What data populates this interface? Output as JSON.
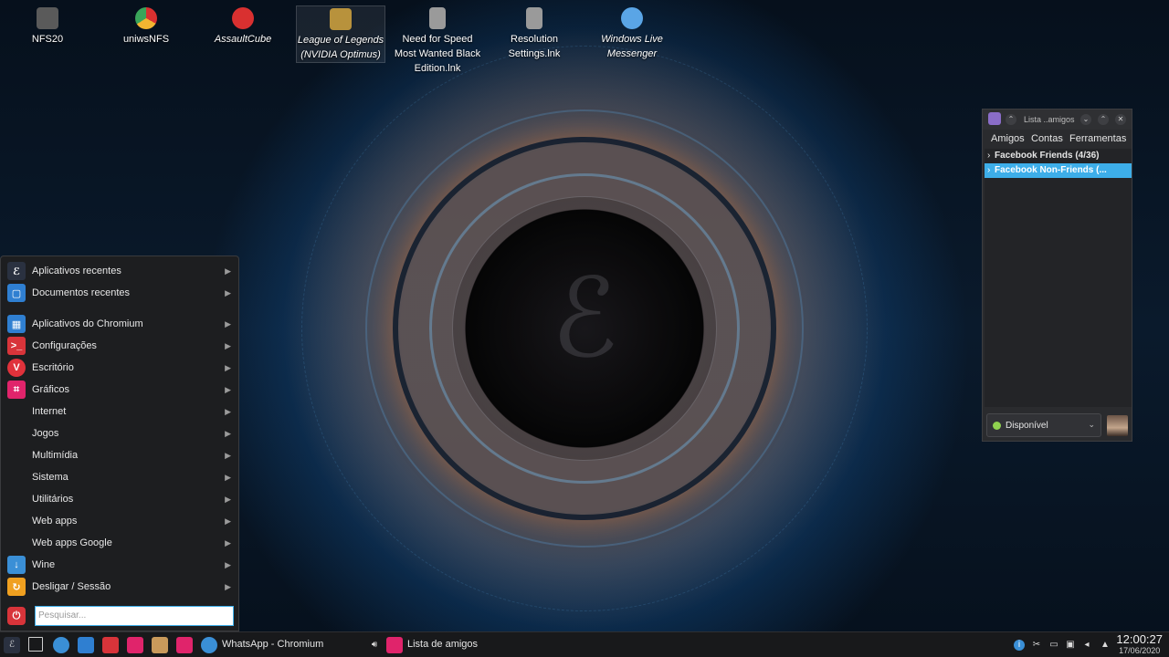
{
  "desktop": {
    "icons": [
      {
        "label": "NFS20",
        "color": "#5a5a5a"
      },
      {
        "label": "uniwsNFS",
        "color": "#f2b531"
      },
      {
        "label": "AssaultCube",
        "color": "#d93030"
      },
      {
        "label": "League of Legends (NVIDIA Optimus)",
        "color": "#b8923c"
      },
      {
        "label": "Need for Speed Most Wanted Black Edition.lnk",
        "color": "#9a9a9a"
      },
      {
        "label": "Resolution Settings.lnk",
        "color": "#9a9a9a"
      },
      {
        "label": "Windows Live Messenger",
        "color": "#5aa5e6"
      }
    ]
  },
  "start_menu": {
    "items": [
      {
        "label": "Aplicativos recentes",
        "icon": "dragon-logo-icon",
        "color": "#2a3140"
      },
      {
        "label": "Documentos recentes",
        "icon": "document-icon",
        "color": "#2f7fd1"
      },
      {
        "label": "Aplicativos do Chromium",
        "icon": "grid-apps-icon",
        "color": "#2f7fd1"
      },
      {
        "label": "Configurações",
        "icon": "terminal-icon",
        "color": "#d8343a"
      },
      {
        "label": "Escritório",
        "icon": "vivaldi-icon",
        "color": "#e0323b"
      },
      {
        "label": "Gráficos",
        "icon": "crop-icon",
        "color": "#e0246b"
      },
      {
        "label": "Internet",
        "icon": "",
        "color": ""
      },
      {
        "label": "Jogos",
        "icon": "",
        "color": ""
      },
      {
        "label": "Multimídia",
        "icon": "",
        "color": ""
      },
      {
        "label": "Sistema",
        "icon": "",
        "color": ""
      },
      {
        "label": "Utilitários",
        "icon": "",
        "color": ""
      },
      {
        "label": "Web apps",
        "icon": "",
        "color": ""
      },
      {
        "label": "Web apps Google",
        "icon": "",
        "color": ""
      },
      {
        "label": "Wine",
        "icon": "download-icon",
        "color": "#3a8fd6"
      },
      {
        "label": "Desligar / Sessão",
        "icon": "refresh-icon",
        "color": "#f0a020"
      }
    ],
    "power_icon_color": "#d8343a",
    "search_placeholder": "Pesquisar..."
  },
  "friends_window": {
    "title": "Lista ..amigos",
    "menu": [
      "Amigos",
      "Contas",
      "Ferramentas"
    ],
    "groups": [
      {
        "label": "Facebook Friends (4/36)",
        "selected": false
      },
      {
        "label": "Facebook Non-Friends (...",
        "selected": true
      }
    ],
    "status": "Disponível",
    "status_color": "#8fd14f"
  },
  "taskbar": {
    "launchers": [
      {
        "name": "show-desktop-icon",
        "color": "#2a2b2e"
      },
      {
        "name": "chromium-icon",
        "color": "#3a8fd6"
      },
      {
        "name": "software-center-icon",
        "color": "#2f7fd1"
      },
      {
        "name": "terminal-icon",
        "color": "#d8343a"
      },
      {
        "name": "pidgin-icon",
        "color": "#e0246b"
      },
      {
        "name": "archive-icon",
        "color": "#c99a5b"
      },
      {
        "name": "crop-icon",
        "color": "#e0246b"
      }
    ],
    "tasks": [
      {
        "label": "WhatsApp - Chromium"
      },
      {
        "label": "Lista de amigos"
      }
    ],
    "clock_time": "12:00:27",
    "clock_date": "17/06/2020"
  }
}
